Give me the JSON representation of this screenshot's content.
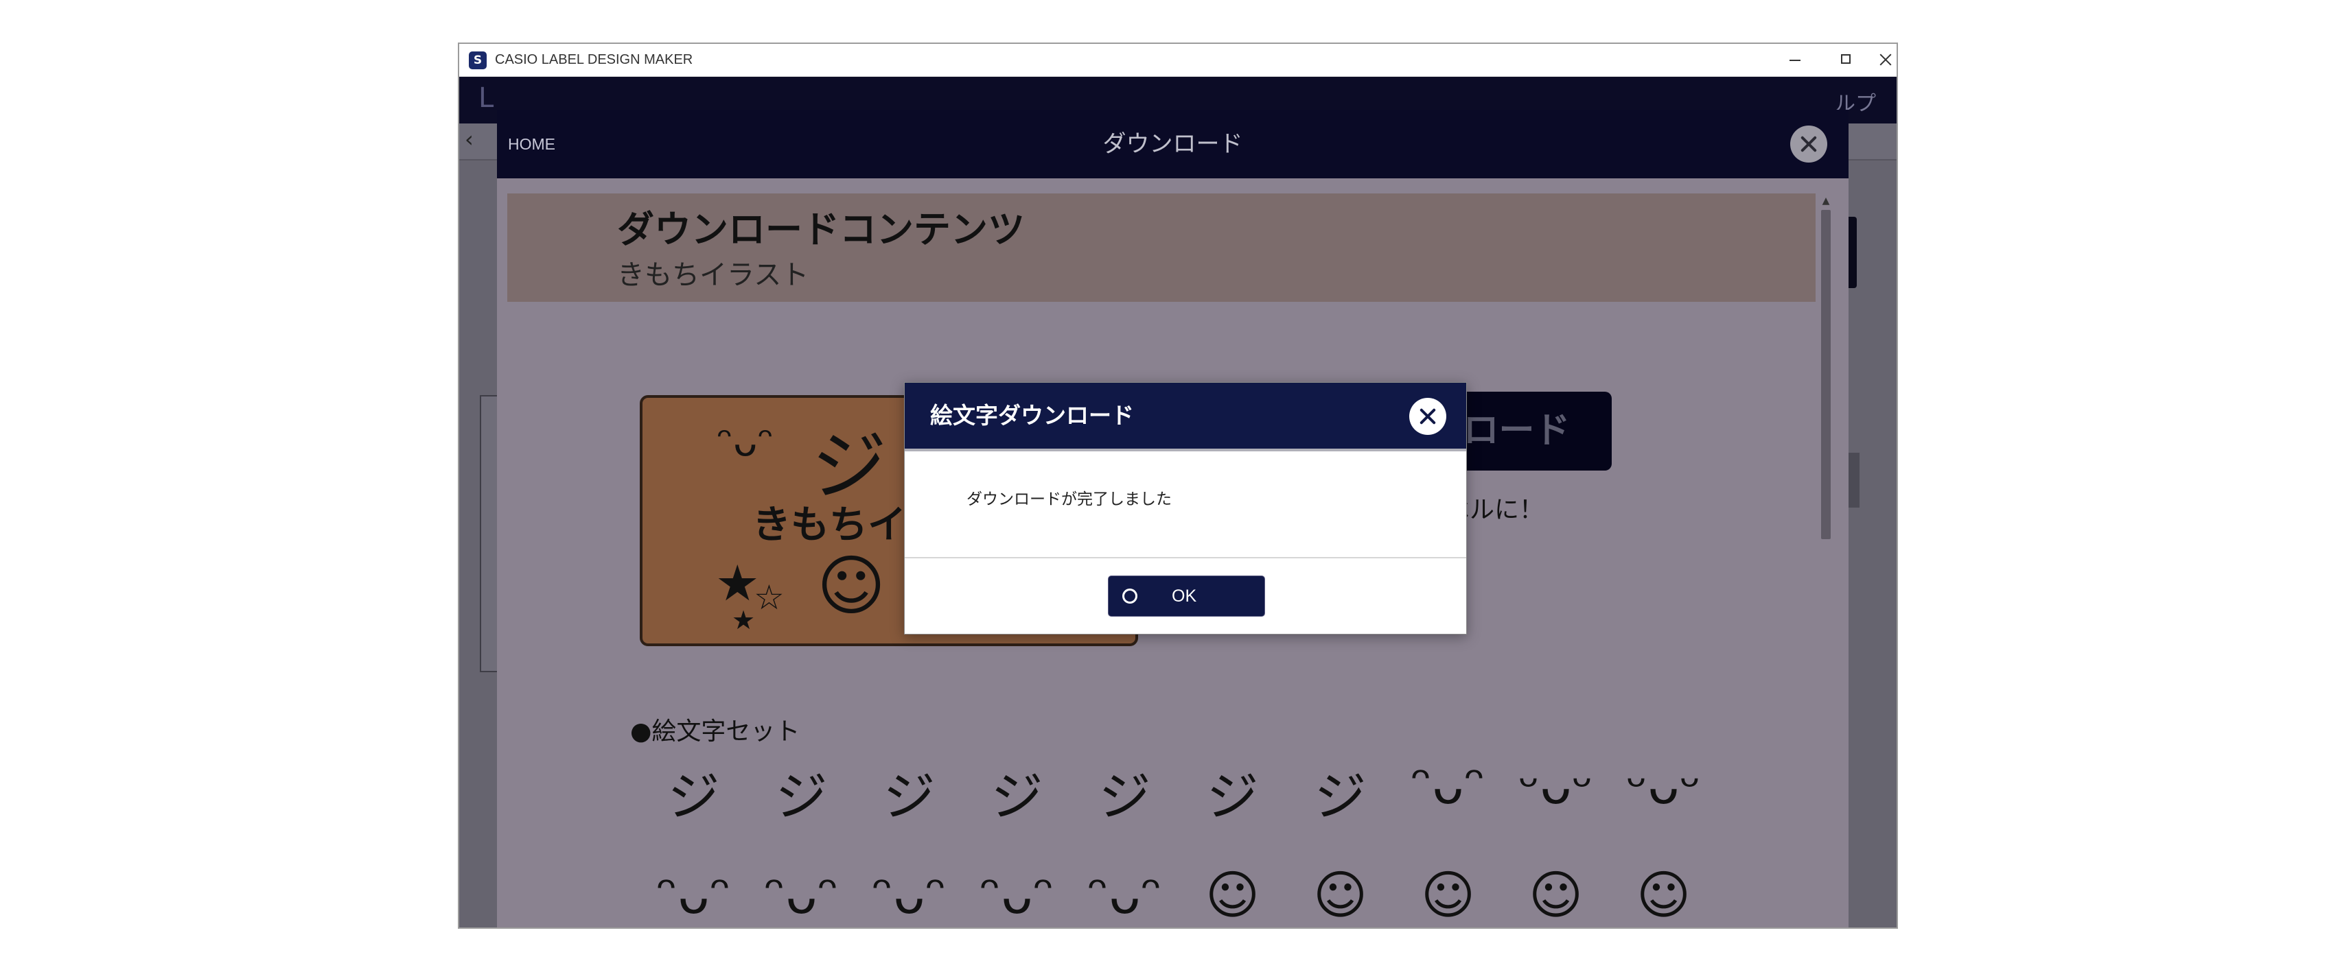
{
  "window": {
    "title": "CASIO LABEL DESIGN MAKER",
    "app_icon_glyph": "S"
  },
  "background_app": {
    "header_left_text": "L",
    "header_right_text": "ルプ",
    "back_glyph": "‹"
  },
  "download_modal": {
    "home_label": "HOME",
    "title": "ダウンロード",
    "content_title": "ダウンロードコンテンツ",
    "content_subtitle": "きもちイラスト",
    "label_preview_text": "きもちイ",
    "action_button_label": "ー ダウンロード",
    "action_description": "ラベルに！",
    "emoji_section_label": "●絵文字セット",
    "emoji_row_1": [
      "ジ",
      "ジ",
      "ジ",
      "ジ",
      "ジ",
      "ジ",
      "ジ",
      "ᵔᴗᵔ",
      "ᵕᴗᵕ",
      "ᵕᴗᵕ"
    ],
    "emoji_row_2": [
      "ᵔᴗᵔ",
      "ᵔᴗᵔ",
      "ᵔᴗᵔ",
      "ᵔᴗᵔ",
      "ᵔᴗᵔ",
      "☺",
      "☺",
      "☺",
      "☺",
      "☺"
    ],
    "card_icons": [
      "star-icon",
      "star-outline-icon",
      "smile-face-icon"
    ]
  },
  "dialog": {
    "title": "絵文字ダウンロード",
    "message": "ダウンロードが完了しました",
    "ok_label": "OK"
  },
  "colors": {
    "dialog_header": "#101846",
    "modal_header": "#0a0a26",
    "label_card": "#86593b"
  }
}
